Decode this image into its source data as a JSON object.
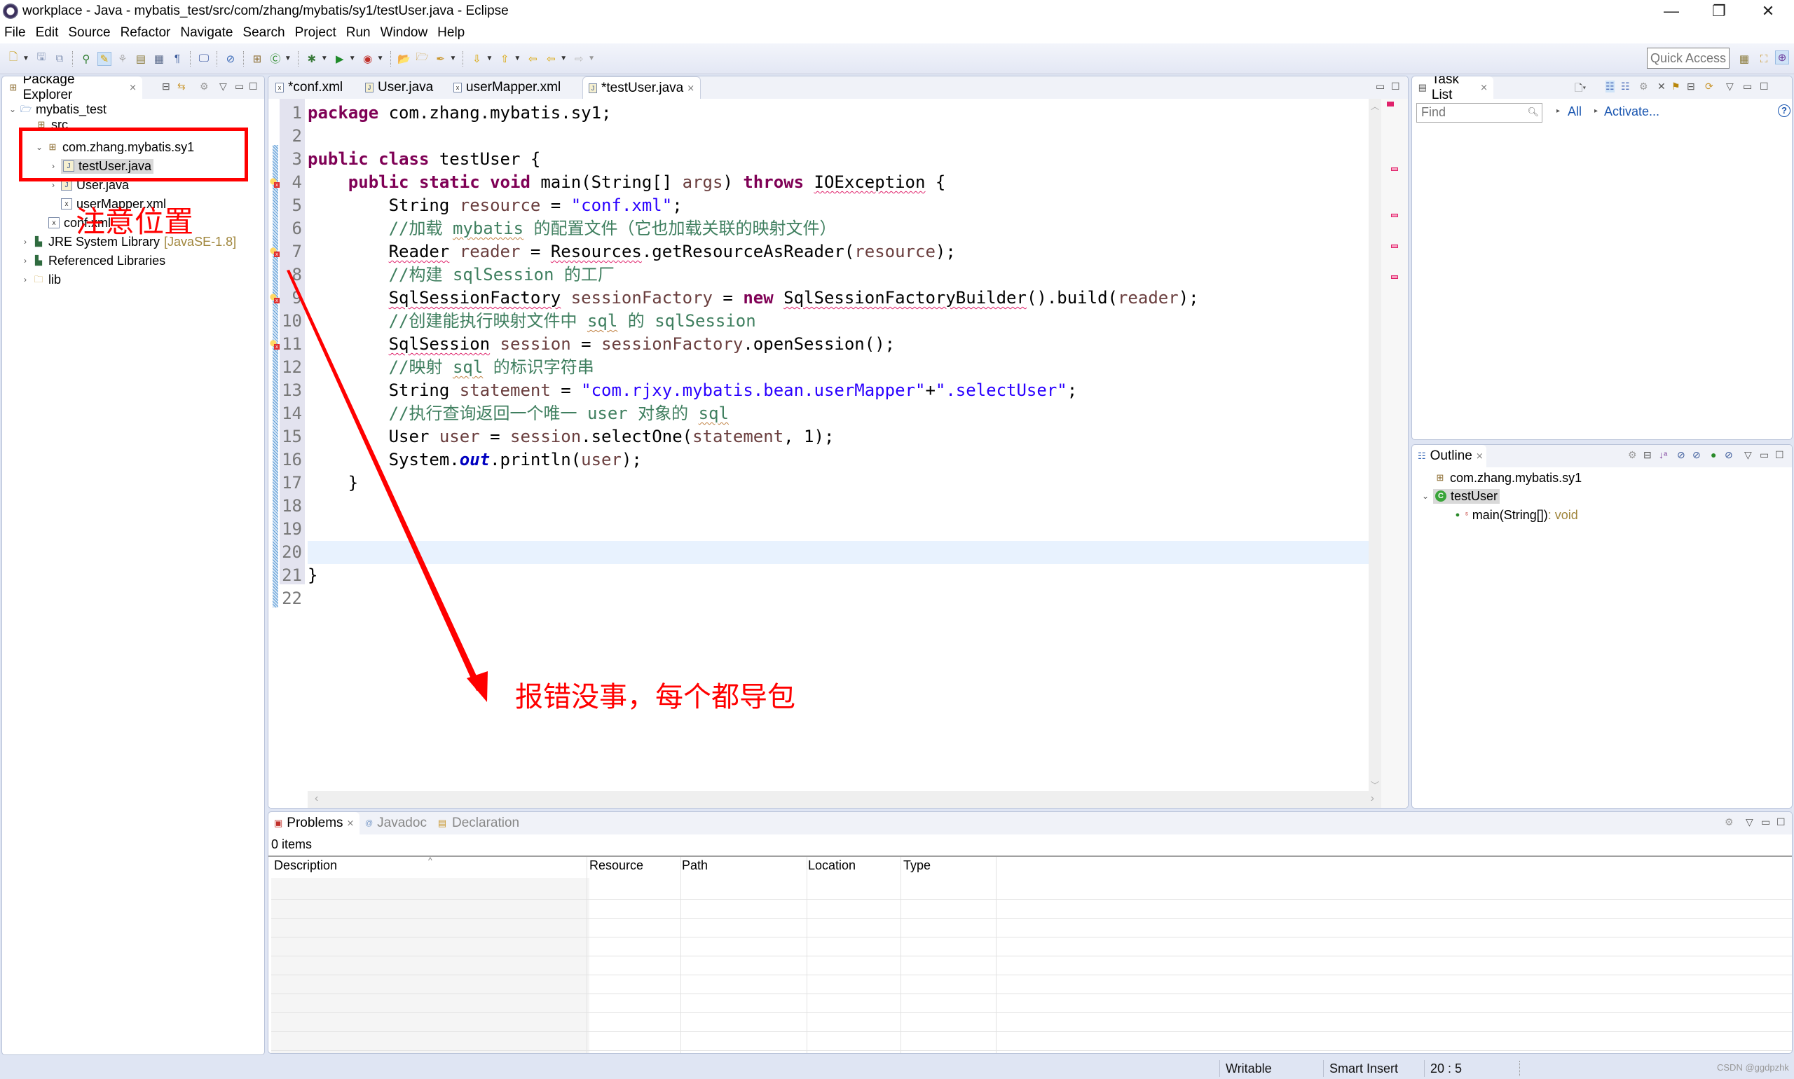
{
  "window": {
    "title": "workplace - Java - mybatis_test/src/com/zhang/mybatis/sy1/testUser.java - Eclipse",
    "minimize": "—",
    "restore": "❐",
    "close": "✕"
  },
  "menu": [
    "File",
    "Edit",
    "Source",
    "Refactor",
    "Navigate",
    "Search",
    "Project",
    "Run",
    "Window",
    "Help"
  ],
  "toolbar": {
    "quick_access": "Quick Access",
    "icons": [
      "new-icon",
      "save-icon",
      "save-all-icon",
      "open-type-icon",
      "highlight-icon",
      "toggle-mark-icon",
      "show-whitespace-icon",
      "block-select-icon",
      "word-wrap-icon",
      "terminal-icon",
      "breakpoint-skip-icon",
      "new-package-icon",
      "new-class-icon",
      "debug-icon",
      "run-icon",
      "run-external-icon",
      "open-task-icon",
      "open-resource-icon",
      "pen-icon",
      "next-annotation-icon",
      "prev-annotation-icon",
      "last-edit-icon",
      "back-icon",
      "forward-icon"
    ]
  },
  "package_explorer": {
    "tab_label": "Package Explorer",
    "tree": [
      {
        "label": "mybatis_test",
        "icon": "project-icon",
        "expanded": true
      },
      {
        "label": "src",
        "icon": "source-folder-icon",
        "expanded": true
      },
      {
        "label": "com.zhang.mybatis.sy1",
        "icon": "package-icon",
        "expanded": true
      },
      {
        "label": "testUser.java",
        "icon": "java-file-icon",
        "selected": true
      },
      {
        "label": "User.java",
        "icon": "java-file-icon"
      },
      {
        "label": "userMapper.xml",
        "icon": "xml-file-icon"
      },
      {
        "label": "conf.xml",
        "icon": "xml-file-icon"
      },
      {
        "label": "JRE System Library",
        "tag": "[JavaSE-1.8]",
        "icon": "library-icon"
      },
      {
        "label": "Referenced Libraries",
        "icon": "library-icon"
      },
      {
        "label": "lib",
        "icon": "folder-icon"
      }
    ]
  },
  "editor": {
    "tabs": [
      {
        "label": "*conf.xml",
        "icon": "xml-file-icon",
        "active": false
      },
      {
        "label": "User.java",
        "icon": "java-file-icon",
        "active": false
      },
      {
        "label": "userMapper.xml",
        "icon": "xml-file-icon",
        "active": false
      },
      {
        "label": "*testUser.java",
        "icon": "java-file-icon",
        "active": true
      }
    ],
    "current_line": 20,
    "error_lines": [
      4,
      7,
      9,
      11
    ],
    "lines": [
      "package com.zhang.mybatis.sy1;",
      "",
      "public class testUser {",
      "    public static void main(String[] args) throws IOException {",
      "        String resource = \"conf.xml\";",
      "        //加载 mybatis 的配置文件（它也加载关联的映射文件）",
      "        Reader reader = Resources.getResourceAsReader(resource);",
      "        //构建 sqlSession 的工厂",
      "        SqlSessionFactory sessionFactory = new SqlSessionFactoryBuilder().build(reader);",
      "        //创建能执行映射文件中 sql 的 sqlSession",
      "        SqlSession session = sessionFactory.openSession();",
      "        //映射 sql 的标识字符串",
      "        String statement = \"com.rjxy.mybatis.bean.userMapper\"+\".selectUser\";",
      "        //执行查询返回一个唯一 user 对象的 sql",
      "        User user = session.selectOne(statement, 1);",
      "        System.out.println(user);",
      "    }",
      "",
      "",
      "",
      "}",
      ""
    ]
  },
  "task_list": {
    "tab_label": "Task List",
    "find_placeholder": "Find",
    "all_link": "All",
    "activate_link": "Activate..."
  },
  "outline": {
    "tab_label": "Outline",
    "items": [
      {
        "label": "com.zhang.mybatis.sy1",
        "icon": "package-icon"
      },
      {
        "label": "testUser",
        "icon": "class-icon",
        "selected": true
      },
      {
        "label": "main(String[])",
        "suffix": " : void",
        "icon": "method-icon"
      }
    ]
  },
  "problems": {
    "tabs": [
      {
        "label": "Problems",
        "active": true
      },
      {
        "label": "Javadoc",
        "active": false
      },
      {
        "label": "Declaration",
        "active": false
      }
    ],
    "count": "0 items",
    "columns": [
      "Description",
      "Resource",
      "Path",
      "Location",
      "Type"
    ],
    "rows": []
  },
  "status_bar": {
    "writable": "Writable",
    "insert_mode": "Smart Insert",
    "position": "20 : 5",
    "watermark": "CSDN @ggdpzhk"
  },
  "annotations": {
    "box_label": "注意位置",
    "arrow_text": "报错没事，每个都导包",
    "color": "#ff0000"
  }
}
